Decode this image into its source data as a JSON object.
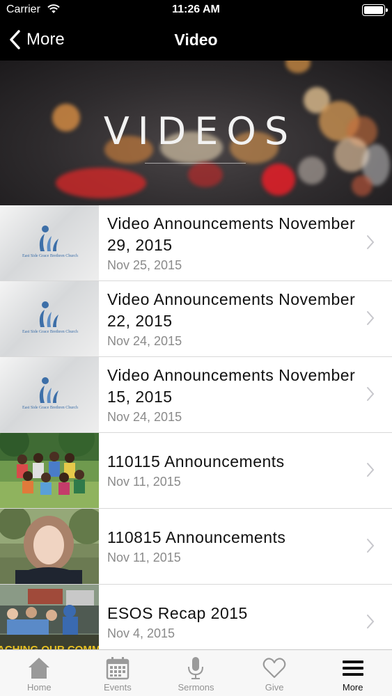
{
  "status_bar": {
    "carrier": "Carrier",
    "time": "11:26 AM"
  },
  "nav": {
    "back_label": "More",
    "title": "Video"
  },
  "hero": {
    "title": "VIDEOS"
  },
  "videos": [
    {
      "title": "Video Announcements November 29, 2015",
      "date": "Nov 25, 2015",
      "thumbnail": "church-logo"
    },
    {
      "title": "Video Announcements November 22, 2015",
      "date": "Nov 24, 2015",
      "thumbnail": "church-logo"
    },
    {
      "title": "Video Announcements November 15, 2015",
      "date": "Nov 24, 2015",
      "thumbnail": "church-logo"
    },
    {
      "title": "110115 Announcements",
      "date": "Nov 11, 2015",
      "thumbnail": "kids-group-photo"
    },
    {
      "title": "110815 Announcements",
      "date": "Nov 11, 2015",
      "thumbnail": "speaker-photo"
    },
    {
      "title": "ESOS Recap 2015",
      "date": "Nov 4, 2015",
      "thumbnail": "community-event-photo"
    }
  ],
  "logo_text": "East Side Grace Brethren Church",
  "thumbnail_caption": "ACHING OUR COMMUN",
  "tabs": [
    {
      "label": "Home",
      "icon": "house-icon",
      "active": false
    },
    {
      "label": "Events",
      "icon": "calendar-icon",
      "active": false
    },
    {
      "label": "Sermons",
      "icon": "microphone-icon",
      "active": false
    },
    {
      "label": "Give",
      "icon": "heart-icon",
      "active": false
    },
    {
      "label": "More",
      "icon": "hamburger-icon",
      "active": true
    }
  ],
  "colors": {
    "nav_background": "#000000",
    "tab_inactive": "#929292",
    "tab_active": "#111111",
    "logo_blue": "#3d6fa8"
  }
}
